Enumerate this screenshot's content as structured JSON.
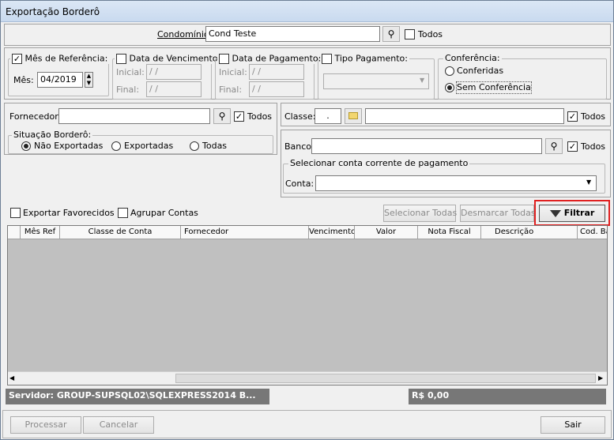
{
  "window": {
    "title": "Exportação Borderô"
  },
  "condominio": {
    "label": "Condomínio:",
    "value": "Cond Teste",
    "todos_label": "Todos",
    "todos_checked": false
  },
  "mes_ref": {
    "label": "Mês de Referência:",
    "checked": true,
    "mes_label": "Mês:",
    "mes_value": "04/2019"
  },
  "data_venc": {
    "label": "Data de Vencimento:",
    "checked": false,
    "inicial_label": "Inicial:",
    "inicial_value": " / /",
    "final_label": "Final:",
    "final_value": " / /"
  },
  "data_pag": {
    "label": "Data de Pagamento:",
    "checked": false,
    "inicial_label": "Inicial:",
    "inicial_value": " / /",
    "final_label": "Final:",
    "final_value": " / /"
  },
  "tipo_pag": {
    "label": "Tipo Pagamento:",
    "checked": false,
    "value": ""
  },
  "conferencia": {
    "title": "Conferência:",
    "options": [
      "Conferidas",
      "Sem Conferência"
    ],
    "selected": "Sem Conferência"
  },
  "fornecedor": {
    "label": "Fornecedor:",
    "value": "",
    "todos_label": "Todos",
    "todos_checked": true
  },
  "classe": {
    "label": "Classe:",
    "code": ".",
    "value": "",
    "todos_label": "Todos",
    "todos_checked": true
  },
  "situacao": {
    "title": "Situação Borderô:",
    "options": [
      "Não Exportadas",
      "Exportadas",
      "Todas"
    ],
    "selected": "Não Exportadas"
  },
  "banco": {
    "label": "Banco:",
    "value": "",
    "todos_label": "Todos",
    "todos_checked": true
  },
  "conta_group": {
    "title": "Selecionar conta corrente de pagamento",
    "conta_label": "Conta:",
    "value": ""
  },
  "options": {
    "exportar_favorecidos": "Exportar Favorecidos",
    "agrupar_contas": "Agrupar Contas"
  },
  "actions": {
    "selecionar_todas": "Selecionar Todas",
    "desmarcar_todas": "Desmarcar Todas",
    "filtrar": "Filtrar"
  },
  "grid": {
    "columns": [
      "",
      "Mês Ref",
      "Classe de Conta",
      "Fornecedor",
      "Vencimento",
      "Valor",
      "Nota Fiscal",
      "Descrição",
      "Cod. Ba"
    ]
  },
  "status": {
    "servidor": "Servidor: GROUP-SUPSQL02\\SQLEXPRESS2014 B...",
    "total": "R$ 0,00"
  },
  "footer": {
    "processar": "Processar",
    "cancelar": "Cancelar",
    "sair": "Sair"
  },
  "colors": {
    "highlight": "#e02020",
    "status_bg": "#777777"
  }
}
